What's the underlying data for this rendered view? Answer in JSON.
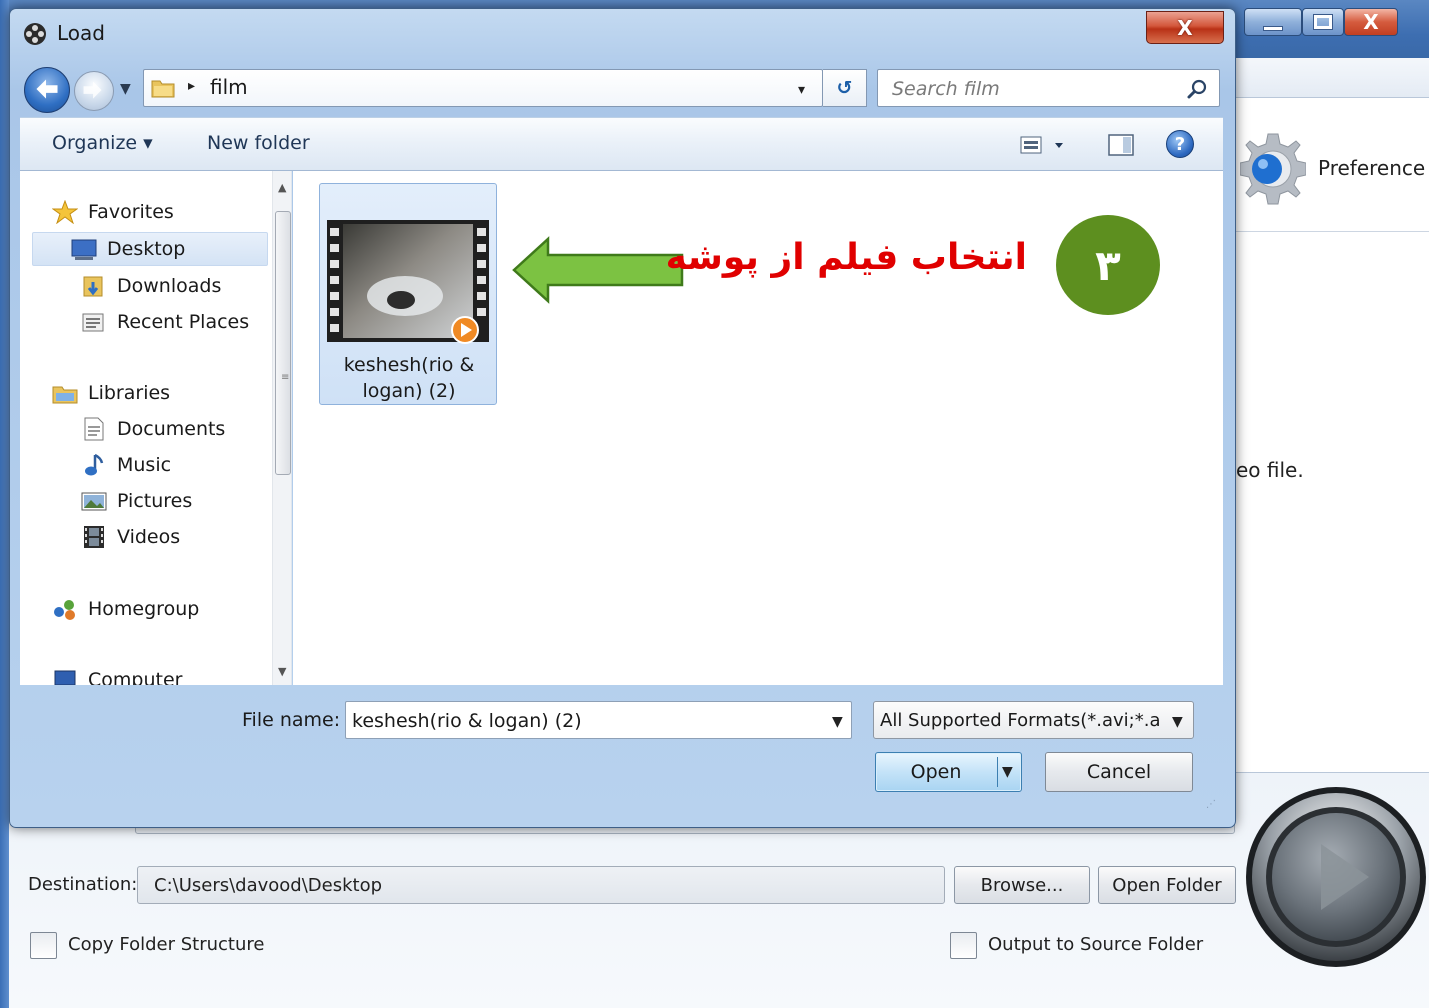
{
  "app": {
    "preference_label": "Preference",
    "video_file_text": "eo file.",
    "destination_label": "Destination:",
    "destination_value": "C:\\Users\\davood\\Desktop",
    "browse_label": "Browse...",
    "open_folder_label": "Open Folder",
    "copy_structure_label": "Copy Folder Structure",
    "output_source_label": "Output to Source Folder",
    "close_glyph": "X"
  },
  "dialog": {
    "title": "Load",
    "close_glyph": "X",
    "address": {
      "breadcrumb_arrow": "▸",
      "folder": "film",
      "dropdown_glyph": "▾"
    },
    "refresh_glyph": "↺",
    "search": {
      "placeholder": "Search film"
    },
    "toolbar": {
      "organize_label": "Organize ▾",
      "new_folder_label": "New folder",
      "help_glyph": "?"
    },
    "nav": {
      "favorites": "Favorites",
      "desktop": "Desktop",
      "downloads": "Downloads",
      "recent_places": "Recent Places",
      "libraries": "Libraries",
      "documents": "Documents",
      "music": "Music",
      "pictures": "Pictures",
      "videos": "Videos",
      "homegroup": "Homegroup",
      "computer": "Computer"
    },
    "files": [
      {
        "name_line1": "keshesh(rio &",
        "name_line2": "logan) (2)"
      }
    ],
    "file_name_label": "File name:",
    "file_name_value": "keshesh(rio & logan) (2)",
    "format_value": "All Supported Formats(*.avi;*.a:",
    "open_label": "Open",
    "cancel_label": "Cancel"
  },
  "annotation": {
    "step_number": "۳",
    "text": "انتخاب فیلم از پوشه",
    "text_color": "#e00000",
    "arrow_color": "#7cc242",
    "badge_color": "#5d8f1f"
  },
  "icons": {
    "title": "film-reel-icon",
    "back": "back-arrow-icon",
    "forward": "forward-arrow-icon",
    "search": "search-icon",
    "help": "help-icon",
    "gear": "gear-icon",
    "play": "play-icon"
  }
}
